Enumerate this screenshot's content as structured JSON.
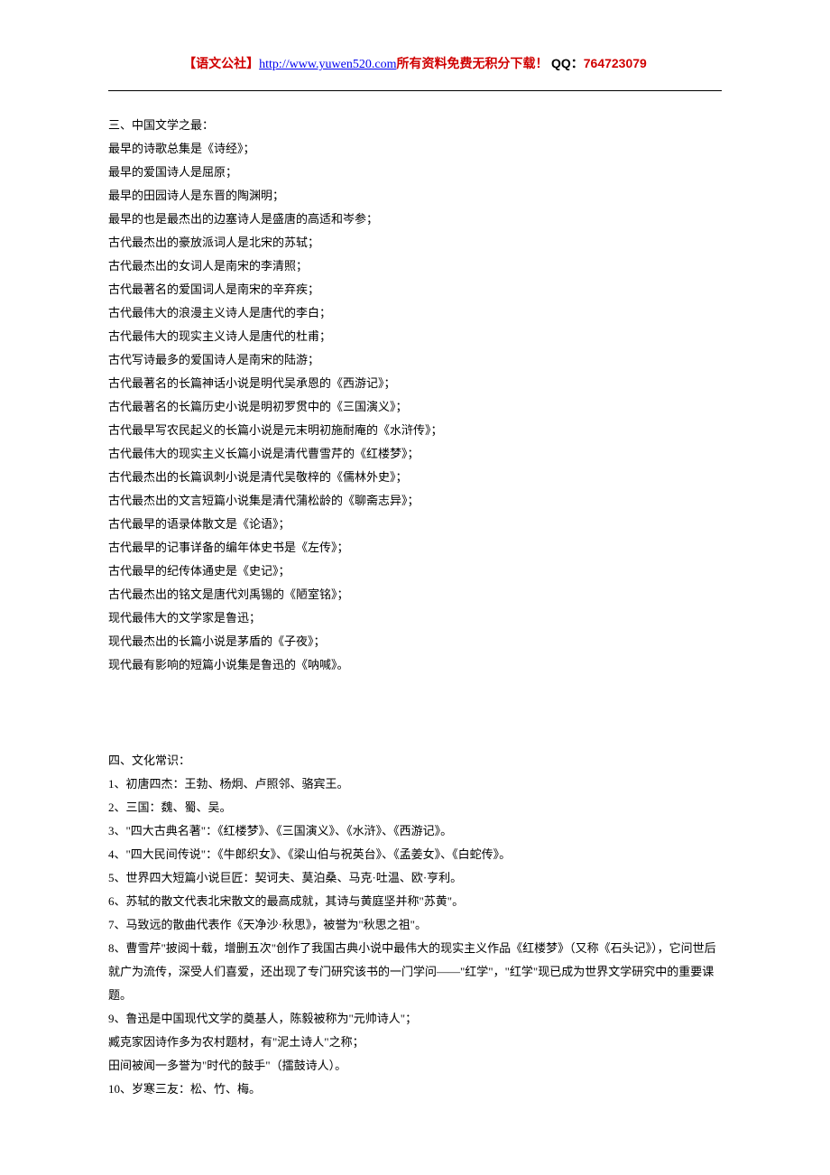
{
  "header": {
    "brand": "【语文公社】",
    "url_text": "http://www.yuwen520.com",
    "tail": "所有资料免费无积分下载！",
    "qq_label": "QQ：",
    "qq_num": "764723079"
  },
  "section3": {
    "heading": "三、中国文学之最：",
    "lines": [
      "最早的诗歌总集是《诗经》；",
      "最早的爱国诗人是屈原；",
      "最早的田园诗人是东晋的陶渊明；",
      "最早的也是最杰出的边塞诗人是盛唐的高适和岑参；",
      "古代最杰出的豪放派词人是北宋的苏轼；",
      "古代最杰出的女词人是南宋的李清照；",
      "古代最著名的爱国词人是南宋的辛弃疾；",
      "古代最伟大的浪漫主义诗人是唐代的李白；",
      "古代最伟大的现实主义诗人是唐代的杜甫；",
      "古代写诗最多的爱国诗人是南宋的陆游；",
      "古代最著名的长篇神话小说是明代吴承恩的《西游记》；",
      "古代最著名的长篇历史小说是明初罗贯中的《三国演义》；",
      "古代最早写农民起义的长篇小说是元末明初施耐庵的《水浒传》；",
      "古代最伟大的现实主义长篇小说是清代曹雪芹的《红楼梦》；",
      "古代最杰出的长篇讽刺小说是清代吴敬梓的《儒林外史》；",
      "古代最杰出的文言短篇小说集是清代蒲松龄的《聊斋志异》；",
      "古代最早的语录体散文是《论语》；",
      "古代最早的记事详备的编年体史书是《左传》；",
      "古代最早的纪传体通史是《史记》；",
      "古代最杰出的铭文是唐代刘禹锡的《陋室铭》；",
      "现代最伟大的文学家是鲁迅；",
      "现代最杰出的长篇小说是茅盾的《子夜》；",
      "现代最有影响的短篇小说集是鲁迅的《呐喊》。"
    ]
  },
  "section4": {
    "heading": "四、文化常识：",
    "lines": [
      "1、初唐四杰：王勃、杨炯、卢照邻、骆宾王。",
      "2、三国：魏、蜀、吴。",
      "3、\"四大古典名著\"：《红楼梦》、《三国演义》、《水浒》、《西游记》。",
      "4、\"四大民间传说\"：《牛郎织女》、《梁山伯与祝英台》、《孟姜女》、《白蛇传》。",
      "5、世界四大短篇小说巨匠：契诃夫、莫泊桑、马克·吐温、欧·亨利。",
      "6、苏轼的散文代表北宋散文的最高成就，其诗与黄庭坚并称\"苏黄\"。",
      "7、马致远的散曲代表作《天净沙·秋思》，被誉为\"秋思之祖\"。",
      "8、曹雪芹\"披阅十载，增删五次\"创作了我国古典小说中最伟大的现实主义作品《红楼梦》（又称《石头记》），它问世后就广为流传，深受人们喜爱，还出现了专门研究该书的一门学问——\"红学\"，\"红学\"现已成为世界文学研究中的重要课题。",
      "9、鲁迅是中国现代文学的奠基人，陈毅被称为\"元帅诗人\"；",
      "臧克家因诗作多为农村题材，有\"泥土诗人\"之称；",
      "田间被闻一多誉为\"时代的鼓手\"（擂鼓诗人）。",
      "10、岁寒三友：松、竹、梅。"
    ]
  }
}
